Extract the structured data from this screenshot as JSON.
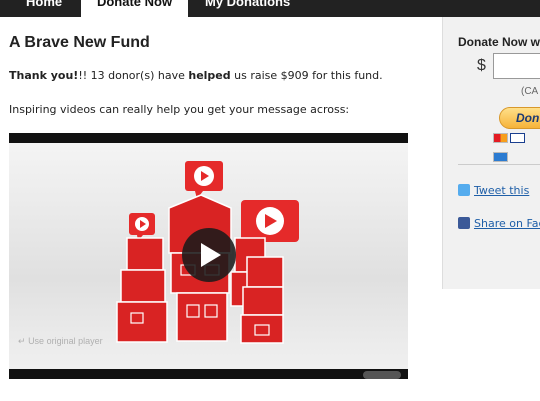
{
  "nav": {
    "tabs": [
      {
        "label": "Home"
      },
      {
        "label": "Donate Now"
      },
      {
        "label": "My Donations"
      }
    ]
  },
  "fund": {
    "title": "A Brave New Fund",
    "thanks_bold": "Thank you!",
    "thanks_rest_1": "!! 13 donor(s) have ",
    "thanks_bold2": "helped",
    "thanks_rest_2": " us raise $909 for this fund.",
    "inspire_text": "Inspiring videos can really help you get your message across:"
  },
  "video": {
    "use_original_label": "Use original player",
    "return_icon": "return-arrow-icon",
    "play_icon": "play-icon"
  },
  "sidebar": {
    "title": "Donate Now w",
    "currency_symbol": "$",
    "amount_value": "",
    "currency_label": "(CA",
    "donate_label": "Don",
    "cards": [
      "mastercard",
      "visa",
      "amex"
    ],
    "share": [
      {
        "label": "Tweet this",
        "icon": "twitter-icon"
      },
      {
        "label": "Share on Face",
        "icon": "facebook-icon"
      }
    ]
  },
  "colors": {
    "nav_bg": "#222222",
    "accent_red": "#e52a2a",
    "link": "#1f5fa8",
    "donate_gold": "#f6b33a"
  }
}
